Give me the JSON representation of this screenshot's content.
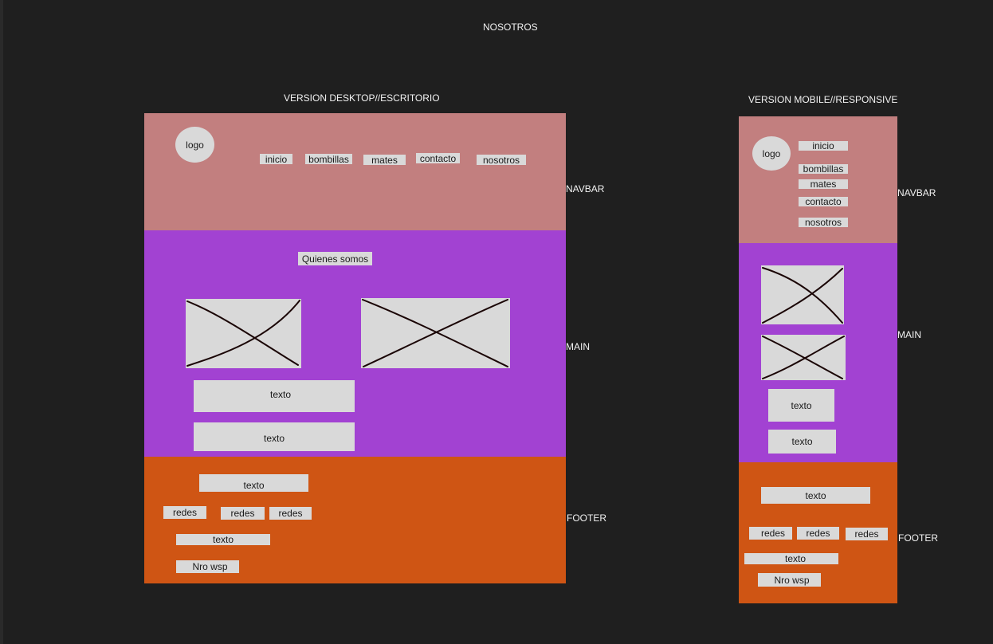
{
  "page_title": "NOSOTROS",
  "desktop": {
    "title": "VERSION DESKTOP//ESCRITORIO",
    "logo": "logo",
    "nav": [
      "inicio",
      "bombillas",
      "mates",
      "contacto",
      "nosotros"
    ],
    "main_heading": "Quienes somos",
    "main_texts": [
      "texto",
      "texto"
    ],
    "footer": {
      "top_text": "texto",
      "redes": [
        "redes",
        "redes",
        "redes"
      ],
      "text2": "texto",
      "wsp": "Nro wsp"
    }
  },
  "mobile": {
    "title": "VERSION MOBILE//RESPONSIVE",
    "logo": "logo",
    "nav": [
      "inicio",
      "bombillas",
      "mates",
      "contacto",
      "nosotros"
    ],
    "main_texts": [
      "texto",
      "texto"
    ],
    "footer": {
      "top_text": "texto",
      "redes": [
        "redes",
        "redes",
        "redes"
      ],
      "text2": "texto",
      "wsp": "Nro wsp"
    }
  },
  "section_labels": {
    "navbar": "NAVBAR",
    "main": "MAIN",
    "footer": "FOOTER"
  },
  "colors": {
    "background": "#1f1f1f",
    "navbar": "#c27f7f",
    "main": "#a242d2",
    "footer": "#cf5514",
    "placeholder": "#d9d9d9"
  }
}
